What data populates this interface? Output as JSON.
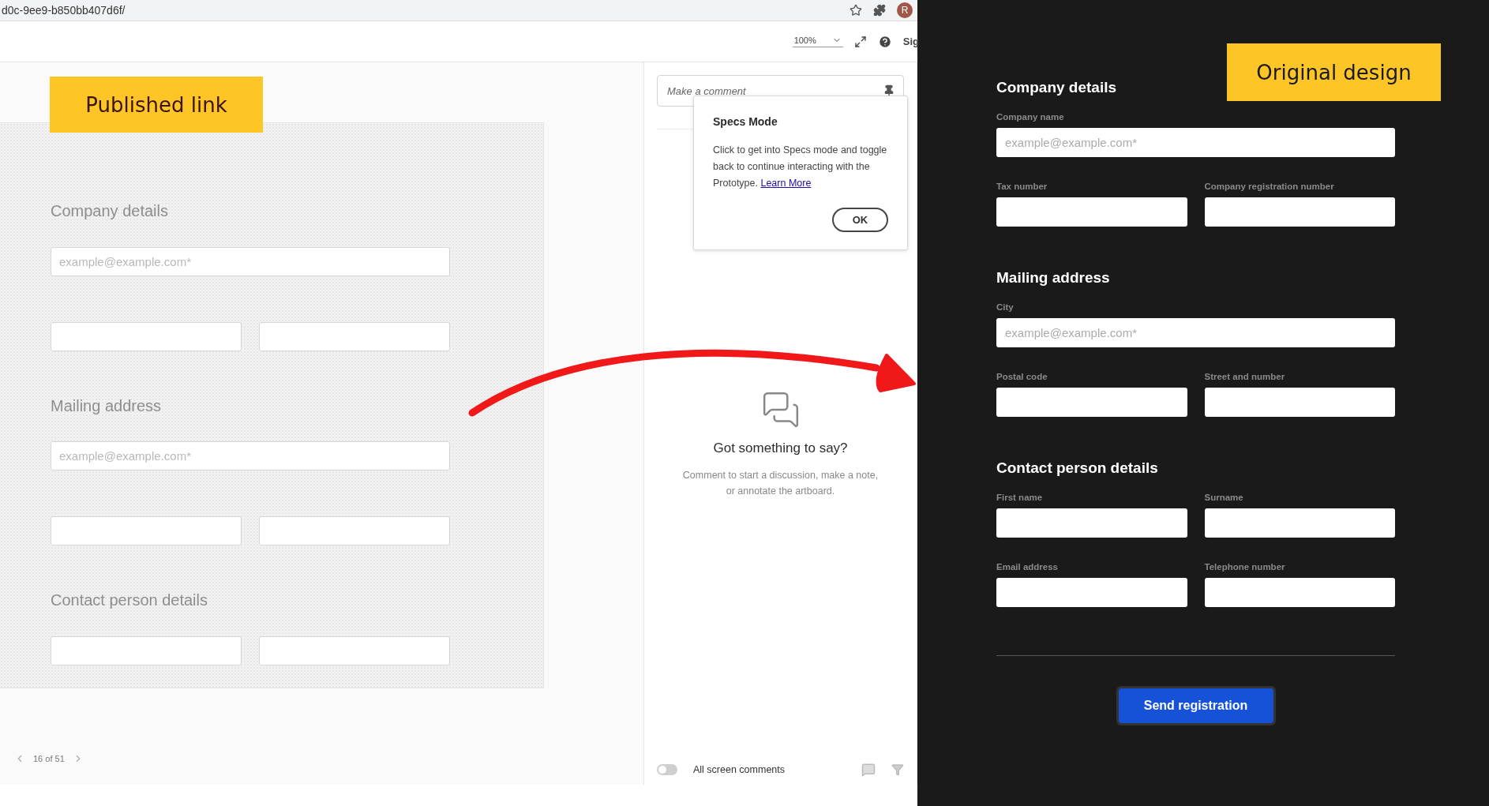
{
  "browser": {
    "url": "d0c-9ee9-b850bb407d6f/",
    "avatar": "R"
  },
  "toolbar": {
    "zoom": "100%",
    "sign_in": "Sig"
  },
  "published_label": "Published link",
  "prototype": {
    "sections": [
      {
        "heading": "Company details",
        "rows": [
          {
            "kind": "wide",
            "placeholder": "example@example.com*"
          },
          {
            "kind": "pair"
          }
        ]
      },
      {
        "heading": "Mailing address",
        "rows": [
          {
            "kind": "wide",
            "placeholder": "example@example.com*"
          },
          {
            "kind": "pair"
          }
        ]
      },
      {
        "heading": "Contact person details",
        "rows": [
          {
            "kind": "pair"
          }
        ]
      }
    ]
  },
  "pagination": "16 of 51",
  "comments": {
    "placeholder": "Make a comment",
    "empty_title": "Got something to say?",
    "empty_text": "Comment to start a discussion, make a note, or annotate the artboard.",
    "toggle": {
      "label": "All screen comments",
      "on": false
    }
  },
  "popup": {
    "title": "Specs Mode",
    "text": "Click to get into Specs mode and toggle back to continue interacting with the Prototype.",
    "link": "Learn More",
    "button": "OK"
  },
  "design_label": "Original design",
  "design": {
    "sections": [
      {
        "heading": "Company details",
        "rows": [
          {
            "kind": "wide",
            "fields": [
              {
                "label": "Company name",
                "placeholder": "example@example.com*"
              }
            ]
          },
          {
            "kind": "pair",
            "fields": [
              {
                "label": "Tax number"
              },
              {
                "label": "Company registration number"
              }
            ]
          }
        ]
      },
      {
        "heading": "Mailing address",
        "rows": [
          {
            "kind": "wide",
            "fields": [
              {
                "label": "City",
                "placeholder": "example@example.com*"
              }
            ]
          },
          {
            "kind": "pair",
            "fields": [
              {
                "label": "Postal code"
              },
              {
                "label": "Street and number"
              }
            ]
          }
        ]
      },
      {
        "heading": "Contact person details",
        "rows": [
          {
            "kind": "pair",
            "fields": [
              {
                "label": "First name"
              },
              {
                "label": "Surname"
              }
            ]
          },
          {
            "kind": "pair",
            "fields": [
              {
                "label": "Email address"
              },
              {
                "label": "Telephone number"
              }
            ]
          }
        ]
      }
    ],
    "submit": "Send registration"
  }
}
